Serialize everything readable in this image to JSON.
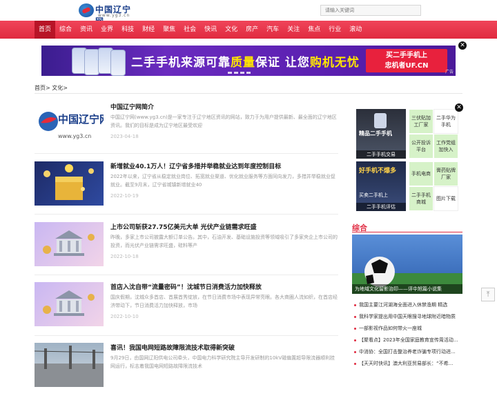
{
  "header": {
    "logo_text": "中国辽宁网",
    "logo_url": "www.yg3.cn",
    "search_placeholder": "请输入关键词"
  },
  "nav": {
    "items": [
      "首页",
      "综合",
      "资讯",
      "业界",
      "科技",
      "财经",
      "聚焦",
      "社会",
      "快讯",
      "文化",
      "房产",
      "汽车",
      "关注",
      "焦点",
      "行业",
      "滚动"
    ],
    "active_index": 0
  },
  "banner": {
    "slogan_a": "二手手机来源可靠",
    "slogan_b": "质量",
    "slogan_c": "保证 让您",
    "slogan_d": "购机无忧",
    "cta_line1": "买二手手机上",
    "cta_line2": "忠机者UF.CN",
    "ad_tag": "广告"
  },
  "breadcrumb": {
    "home": "首页",
    "sep1": ">",
    "section": "文化",
    "sep2": ">"
  },
  "articles": [
    {
      "title": "中国辽宁网简介",
      "desc": "中国辽宁网(www.yg3.cn)是一家专注于辽宁地区资讯的网站，致力于为用户提供最新、最全面的辽宁地区资讯。我们的目标是成为辽宁地区最受欢迎",
      "date": "2023-04-18"
    },
    {
      "title": "新增就业40.1万人！辽宁省多措并举稳就业达到年度控制目标",
      "desc": "2022年以来，辽宁省从稳定就业岗位、拓宽就业渠道、优化就业服务等方面同向发力，多措并举稳就业促就业。截至9月末，辽宁省城镇新增就业40",
      "date": "2022-10-19"
    },
    {
      "title": "上市公司斩获27.75亿美元大单 光伏产业链需求旺盛",
      "desc": "昨晚，多家上市公司披露大额订单公告。其中，石油开发、基础设施投资等领域吸引了多家央企上市公司的投资，而光伏产业链需求旺盛，硅料等产",
      "date": "2022-10-18"
    },
    {
      "title": "首店入沈自带“流量密码”！沈城节日消费活力加快释放",
      "desc": "国庆假期，沈城众多首店、首展首秀绽放，在节日消费市场中表现异常亮眼。各大商圈人流如织，在首店经济带动下，节日消费活力加快释放，市场",
      "date": "2022-10-10"
    },
    {
      "title": "喜讯！我国电网短路故障限流技术取得新突破",
      "desc": "9月29日，由国网辽阳供电公司牵头，中国电力科学研究院主导开发研制的10kV磁偏置超导限流器顺利挂网运行，标志着我国电网短路故障限流技术",
      "date": ""
    }
  ],
  "side_ads": {
    "img1_caption": "二手手机交易",
    "img2_caption": "二手手机评估",
    "img1_promo": "精品二手手机",
    "img2_promo_a": "好手机不爆多",
    "img2_promo_b": "买卖二手机上",
    "boxes": [
      "三伏贴加工厂家",
      "二手华为手机",
      "公开投诉平台",
      "工作党组加快入",
      "手机电商",
      "膏药贴牌厂家",
      "二手手机商城",
      "图片下载"
    ]
  },
  "section": {
    "title": "综合",
    "feature_caption": "为地域文化留影治印——评中旭篇小说集",
    "list": [
      "我国主要江河湖海全面进入休禁渔期 精选",
      "我科学家提出用中国天眼搜寻地球附近暗物质",
      "一部影视作品如何带火一座城",
      "【聚看点】2023年全国家庭教育宣传周活动...",
      "中消协：全国打击整治养老诈骗专项行动进...",
      "【天天时快讯】澳大利亚贸易部长：“不希..."
    ]
  },
  "colors": {
    "brand_red": "#e02a40",
    "nav_active": "#b81427"
  }
}
